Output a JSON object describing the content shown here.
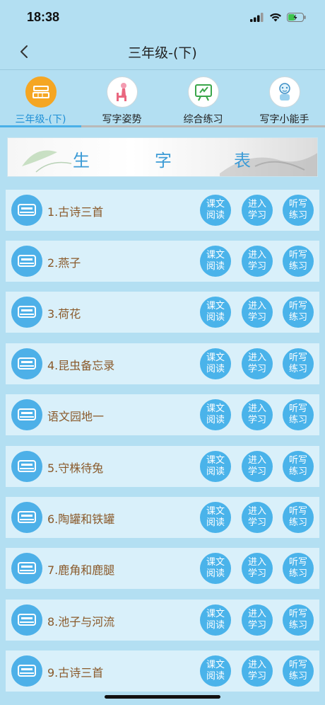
{
  "status": {
    "time": "18:38"
  },
  "nav": {
    "title": "三年级-(下)"
  },
  "tabs": [
    {
      "label": "三年级-(下)",
      "icon": "book-stack-icon",
      "active": true
    },
    {
      "label": "写字姿势",
      "icon": "writing-posture-icon",
      "active": false
    },
    {
      "label": "综合练习",
      "icon": "exercise-board-icon",
      "active": false
    },
    {
      "label": "写字小能手",
      "icon": "handwriting-character-icon",
      "active": false
    }
  ],
  "banner": {
    "chars": [
      "生",
      "字",
      "表"
    ]
  },
  "actions": {
    "read": [
      "课文",
      "阅读"
    ],
    "study": [
      "进入",
      "学习"
    ],
    "dictation": [
      "听写",
      "练习"
    ]
  },
  "lessons": [
    {
      "title": "1.古诗三首"
    },
    {
      "title": "2.燕子"
    },
    {
      "title": "3.荷花"
    },
    {
      "title": "4.昆虫备忘录"
    },
    {
      "title": "语文园地一"
    },
    {
      "title": "5.守株待兔"
    },
    {
      "title": "6.陶罐和铁罐"
    },
    {
      "title": "7.鹿角和鹿腿"
    },
    {
      "title": "8.池子与河流"
    },
    {
      "title": "9.古诗三首"
    }
  ],
  "colors": {
    "background": "#b3dff2",
    "accent": "#4ab3ea",
    "tab_active": "#f5a623",
    "title_text": "#8a5a2b"
  }
}
